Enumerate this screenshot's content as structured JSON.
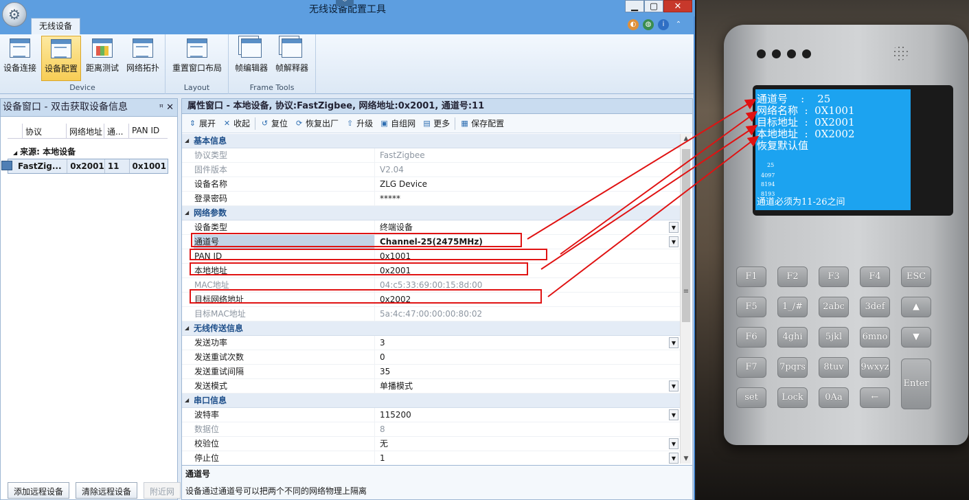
{
  "window": {
    "title": "无线设备配置工具",
    "controls": {
      "minimize": "▁",
      "maximize": "▢",
      "close": "✕"
    }
  },
  "tabs": [
    {
      "label": "无线设备"
    }
  ],
  "ribbon": {
    "groups": [
      {
        "label": "Device",
        "buttons": [
          "设备连接",
          "设备配置",
          "距离测试",
          "网络拓扑"
        ]
      },
      {
        "label": "Layout",
        "buttons": [
          "重置窗口布局"
        ]
      },
      {
        "label": "Frame Tools",
        "buttons": [
          "帧编辑器",
          "帧解释器"
        ]
      }
    ],
    "active_button": "设备配置"
  },
  "left_pane": {
    "title": "设备窗口 - 双击获取设备信息",
    "pin": "ꟸ",
    "close": "✕",
    "columns": [
      "协议",
      "网络地址",
      "通...",
      "PAN ID"
    ],
    "source_label": "来源: 本地设备",
    "rows": [
      [
        "FastZig...",
        "0x2001",
        "11",
        "0x1001"
      ]
    ],
    "buttons": [
      "添加远程设备",
      "清除远程设备",
      "附近网"
    ]
  },
  "right_pane": {
    "title": "属性窗口 - 本地设备, 协议:FastZigbee, 网络地址:0x2001, 通道号:11",
    "toolbar": [
      "展开",
      "收起",
      "复位",
      "恢复出厂",
      "升级",
      "自组网",
      "更多",
      "保存配置"
    ],
    "sections": [
      {
        "title": "基本信息",
        "rows": [
          {
            "key": "协议类型",
            "value": "FastZigbee",
            "dim": true
          },
          {
            "key": "固件版本",
            "value": "V2.04",
            "dim": true
          },
          {
            "key": "设备名称",
            "value": "ZLG Device"
          },
          {
            "key": "登录密码",
            "value": "*****"
          }
        ]
      },
      {
        "title": "网络参数",
        "rows": [
          {
            "key": "设备类型",
            "value": "终端设备",
            "dropdown": true
          },
          {
            "key": "通道号",
            "value": "Channel-25(2475MHz)",
            "dropdown": true
          },
          {
            "key": "PAN ID",
            "value": "0x1001"
          },
          {
            "key": "本地地址",
            "value": "0x2001"
          },
          {
            "key": "MAC地址",
            "value": "04:c5:33:69:00:15:8d:00",
            "dim": true
          },
          {
            "key": "目标网络地址",
            "value": "0x2002"
          },
          {
            "key": "目标MAC地址",
            "value": "5a:4c:47:00:00:00:80:02",
            "dim": true
          }
        ]
      },
      {
        "title": "无线传送信息",
        "rows": [
          {
            "key": "发送功率",
            "value": "3",
            "dropdown": true
          },
          {
            "key": "发送重试次数",
            "value": "0"
          },
          {
            "key": "发送重试间隔",
            "value": "35"
          },
          {
            "key": "发送模式",
            "value": "单播模式",
            "dropdown": true
          }
        ]
      },
      {
        "title": "串口信息",
        "rows": [
          {
            "key": "波特率",
            "value": "115200",
            "dropdown": true
          },
          {
            "key": "数据位",
            "value": "8",
            "dim": true
          },
          {
            "key": "校验位",
            "value": "无",
            "dropdown": true
          },
          {
            "key": "停止位",
            "value": "1",
            "dropdown": true
          }
        ]
      }
    ],
    "selected_row": "通道号",
    "description": {
      "title": "通道号",
      "text": "设备通过通道号可以把两个不同的网络物理上隔离"
    }
  },
  "device_photo": {
    "lcd_lines": [
      "通道号    :    25",
      "网络名称  :  0X1001",
      "目标地址  :  0X2001",
      "本地地址  :  0X2002",
      "恢复默认值"
    ],
    "lcd_small": [
      "25",
      "4097",
      "8194",
      "8193"
    ],
    "lcd_footer": "通道必须为11-26之间",
    "keys": [
      "F1",
      "F2",
      "F3",
      "F4",
      "ESC",
      "F5",
      "1_/#",
      "2abc",
      "3def",
      "▲",
      "F6",
      "4ghi",
      "5jkl",
      "6mno",
      "▼",
      "F7",
      "7pqrs",
      "8tuv",
      "9wxyz",
      "Enter",
      "set",
      "Lock",
      "0Aa",
      "←"
    ]
  },
  "colors": {
    "highlight": "#e01212",
    "lcd": "#1ca3f0",
    "titlebar": "#5d9ee0"
  }
}
